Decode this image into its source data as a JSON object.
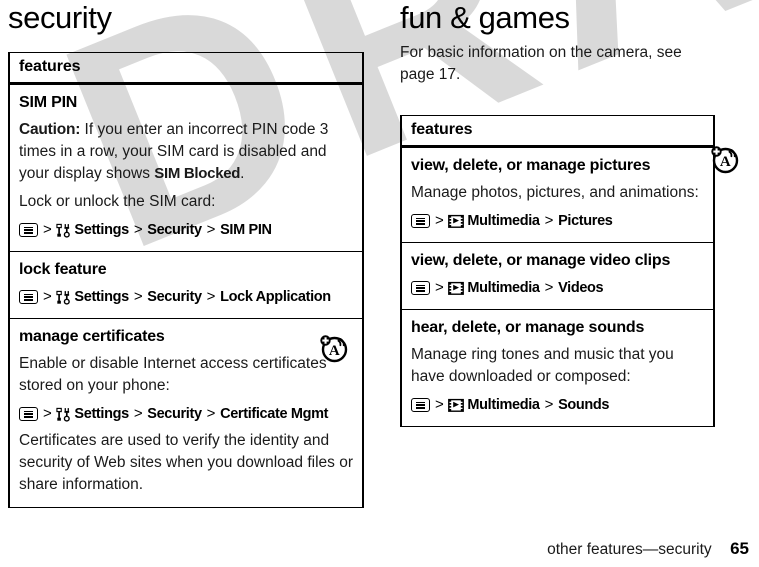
{
  "watermark": {
    "text": "DRAFT",
    "color": "#d9d9d9"
  },
  "left_column": {
    "chapter_title": "security",
    "table": {
      "header": "features",
      "rows": [
        {
          "title": "SIM PIN",
          "paragraphs": [
            {
              "lead": "Caution:",
              "text": " If you enter an incorrect PIN code 3 times in a row, your SIM card is disabled and your display shows ",
              "bold_tail": "SIM Blocked",
              "tail": "."
            },
            {
              "text": "Lock or unlock the SIM card:"
            }
          ],
          "path": {
            "menu_icon": "menu-key-icon",
            "app_icon": "settings-icon",
            "steps": [
              "Settings",
              "Security",
              "SIM PIN"
            ]
          }
        },
        {
          "title": "lock feature",
          "paragraphs": [],
          "path": {
            "menu_icon": "menu-key-icon",
            "app_icon": "settings-icon",
            "steps": [
              "Settings",
              "Security",
              "Lock Application"
            ]
          }
        },
        {
          "title": "manage certificates",
          "marker_icon": "antenna-a-circle-icon",
          "paragraphs": [
            {
              "text": "Enable or disable Internet access certificates stored on your phone:"
            }
          ],
          "path": {
            "menu_icon": "menu-key-icon",
            "app_icon": "settings-icon",
            "steps": [
              "Settings",
              "Security",
              "Certificate Mgmt"
            ]
          },
          "after_paragraphs": [
            {
              "text": "Certificates are used to verify the identity and security of Web sites when you download files or share information."
            }
          ]
        }
      ]
    }
  },
  "right_column": {
    "chapter_title": "fun & games",
    "intro": "For basic information on the camera, see page 17.",
    "table": {
      "header": "features",
      "rows": [
        {
          "title": "view, delete, or manage pictures",
          "marker_icon": "antenna-a-circle-icon",
          "paragraphs": [
            {
              "text": "Manage photos, pictures, and animations:"
            }
          ],
          "path": {
            "menu_icon": "menu-key-icon",
            "app_icon": "multimedia-icon",
            "steps": [
              "Multimedia",
              "Pictures"
            ]
          }
        },
        {
          "title": "view, delete, or manage video clips",
          "paragraphs": [],
          "path": {
            "menu_icon": "menu-key-icon",
            "app_icon": "multimedia-icon",
            "steps": [
              "Multimedia",
              "Videos"
            ]
          }
        },
        {
          "title": "hear, delete, or manage sounds",
          "paragraphs": [
            {
              "text": "Manage ring tones and music that you have downloaded or composed:"
            }
          ],
          "path": {
            "menu_icon": "menu-key-icon",
            "app_icon": "multimedia-icon",
            "steps": [
              "Multimedia",
              "Sounds"
            ]
          }
        }
      ]
    }
  },
  "footer": {
    "label": "other features—security",
    "page_number": "65"
  }
}
